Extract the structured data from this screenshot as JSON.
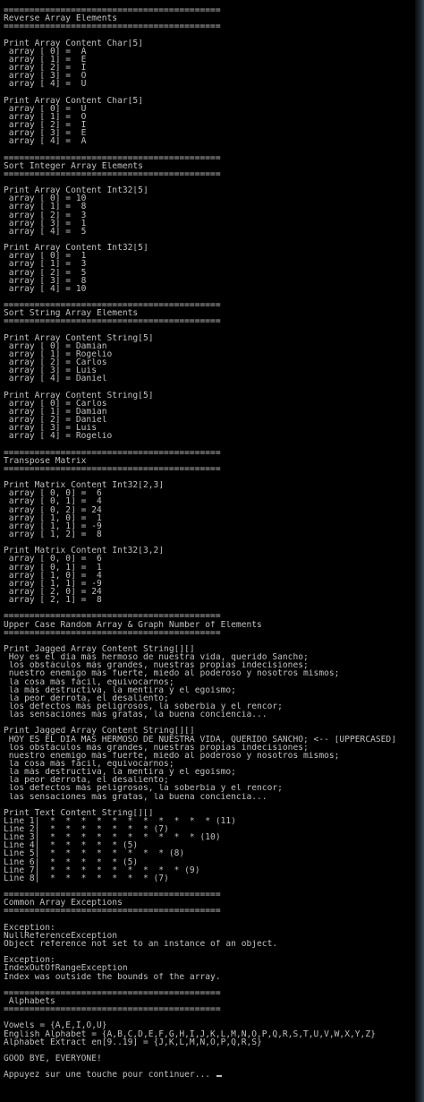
{
  "lines": [
    "==========================================",
    "Reverse Array Elements",
    "==========================================",
    "",
    "Print Array Content Char[5]",
    " array [ 0] =  A",
    " array [ 1] =  E",
    " array [ 2] =  I",
    " array [ 3] =  O",
    " array [ 4] =  U",
    "",
    "Print Array Content Char[5]",
    " array [ 0] =  U",
    " array [ 1] =  O",
    " array [ 2] =  I",
    " array [ 3] =  E",
    " array [ 4] =  A",
    "",
    "==========================================",
    "Sort Integer Array Elements",
    "==========================================",
    "",
    "Print Array Content Int32[5]",
    " array [ 0] = 10",
    " array [ 1] =  8",
    " array [ 2] =  3",
    " array [ 3] =  1",
    " array [ 4] =  5",
    "",
    "Print Array Content Int32[5]",
    " array [ 0] =  1",
    " array [ 1] =  3",
    " array [ 2] =  5",
    " array [ 3] =  8",
    " array [ 4] = 10",
    "",
    "==========================================",
    "Sort String Array Elements",
    "==========================================",
    "",
    "Print Array Content String[5]",
    " array [ 0] = Damian",
    " array [ 1] = Rogelio",
    " array [ 2] = Carlos",
    " array [ 3] = Luis",
    " array [ 4] = Daniel",
    "",
    "Print Array Content String[5]",
    " array [ 0] = Carlos",
    " array [ 1] = Damian",
    " array [ 2] = Daniel",
    " array [ 3] = Luis",
    " array [ 4] = Rogelio",
    "",
    "==========================================",
    "Transpose Matrix",
    "==========================================",
    "",
    "Print Matrix Content Int32[2,3]",
    " array [ 0, 0] =  6",
    " array [ 0, 1] =  4",
    " array [ 0, 2] = 24",
    " array [ 1, 0] =  1",
    " array [ 1, 1] = -9",
    " array [ 1, 2] =  8",
    "",
    "Print Matrix Content Int32[3,2]",
    " array [ 0, 0] =  6",
    " array [ 0, 1] =  1",
    " array [ 1, 0] =  4",
    " array [ 1, 1] = -9",
    " array [ 2, 0] = 24",
    " array [ 2, 1] =  8",
    "",
    "==========================================",
    "Upper Case Random Array & Graph Number of Elements",
    "==========================================",
    "",
    "Print Jagged Array Content String[][]",
    " Hoy es el día más hermoso de nuestra vida, querido Sancho;",
    " los obstáculos más grandes, nuestras propias indecisiones;",
    " nuestro enemigo más fuerte, miedo al poderoso y nosotros mismos;",
    " la cosa más fácil, equivocarnos;",
    " la más destructiva, la mentira y el egoísmo;",
    " la peor derrota, el desaliento;",
    " los defectos más peligrosos, la soberbia y el rencor;",
    " las sensaciones más gratas, la buena conciencia...",
    "",
    "Print Jagged Array Content String[][]",
    " HOY ES EL DÍA MÁS HERMOSO DE NUESTRA VIDA, QUERIDO SANCHO; <-- [UPPERCASED]",
    " los obstáculos más grandes, nuestras propias indecisiones;",
    " nuestro enemigo más fuerte, miedo al poderoso y nosotros mismos;",
    " la cosa más fácil, equivocarnos;",
    " la más destructiva, la mentira y el egoísmo;",
    " la peor derrota, el desaliento;",
    " los defectos más peligrosos, la soberbia y el rencor;",
    " las sensaciones más gratas, la buena conciencia...",
    "",
    "Print Text Content String[][]",
    "Line 1|  *  *  *  *  *  *  *  *  *  *  * (11)",
    "Line 2|  *  *  *  *  *  *  * (7)",
    "Line 3|  *  *  *  *  *  *  *  *  *  * (10)",
    "Line 4|  *  *  *  *  * (5)",
    "Line 5|  *  *  *  *  *  *  *  * (8)",
    "Line 6|  *  *  *  *  * (5)",
    "Line 7|  *  *  *  *  *  *  *  *  * (9)",
    "Line 8|  *  *  *  *  *  *  * (7)",
    "",
    "==========================================",
    "Common Array Exceptions",
    "==========================================",
    "",
    "Exception:",
    "NullReferenceException",
    "Object reference not set to an instance of an object.",
    "",
    "Exception:",
    "IndexOutOfRangeException",
    "Index was outside the bounds of the array.",
    "",
    "==========================================",
    " Alphabets",
    "==========================================",
    "",
    "Vowels = {A,E,I,O,U}",
    "English Alphabet = {A,B,C,D,E,F,G,H,I,J,K,L,M,N,O,P,Q,R,S,T,U,V,W,X,Y,Z}",
    "Alphabet Extract en[9..19] = {J,K,L,M,N,O,P,Q,R,S}",
    "",
    "GOOD BYE, EVERYONE!",
    ""
  ],
  "prompt": "Appuyez sur une touche pour continuer... "
}
